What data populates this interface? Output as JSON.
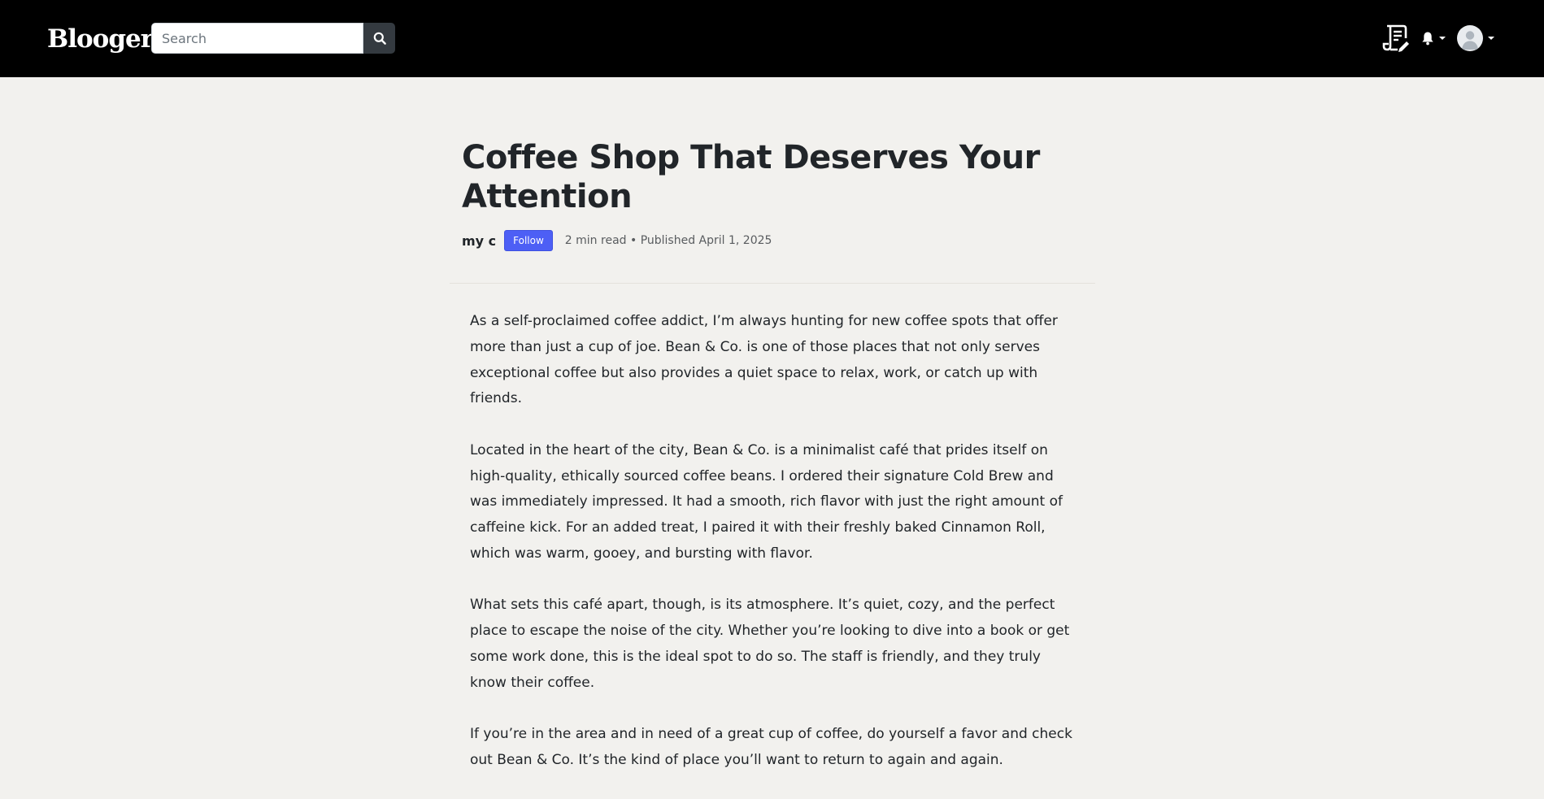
{
  "header": {
    "logo": "Blooger.",
    "search": {
      "placeholder": "Search",
      "value": ""
    },
    "icons": {
      "search": "search-icon",
      "write": "write-post-icon",
      "notifications": "bell-icon",
      "avatar": "user-avatar-icon",
      "dropdown": "chevron-down-icon"
    }
  },
  "article": {
    "title": "Coffee Shop That Deserves Your Attention",
    "author": "my c",
    "follow_label": "Follow",
    "meta": "2 min read • Published April 1, 2025",
    "paragraphs": [
      "As a self-proclaimed coffee addict, I’m always hunting for new coffee spots that offer more than just a cup of joe. Bean & Co. is one of those places that not only serves exceptional coffee but also provides a quiet space to relax, work, or catch up with friends.",
      "Located in the heart of the city, Bean & Co. is a minimalist café that prides itself on high-quality, ethically sourced coffee beans. I ordered their signature Cold Brew and was immediately impressed. It had a smooth, rich flavor with just the right amount of caffeine kick. For an added treat, I paired it with their freshly baked Cinnamon Roll, which was warm, gooey, and bursting with flavor.",
      "What sets this café apart, though, is its atmosphere. It’s quiet, cozy, and the perfect place to escape the noise of the city. Whether you’re looking to dive into a book or get some work done, this is the ideal spot to do so. The staff is friendly, and they truly know their coffee.",
      "If you’re in the area and in need of a great cup of coffee, do yourself a favor and check out Bean & Co. It’s the kind of place you’ll want to return to again and again."
    ]
  },
  "colors": {
    "header_bg": "#000000",
    "page_bg": "#f2f1ee",
    "follow_button": "#4d5ff5",
    "search_button": "#343a40"
  }
}
